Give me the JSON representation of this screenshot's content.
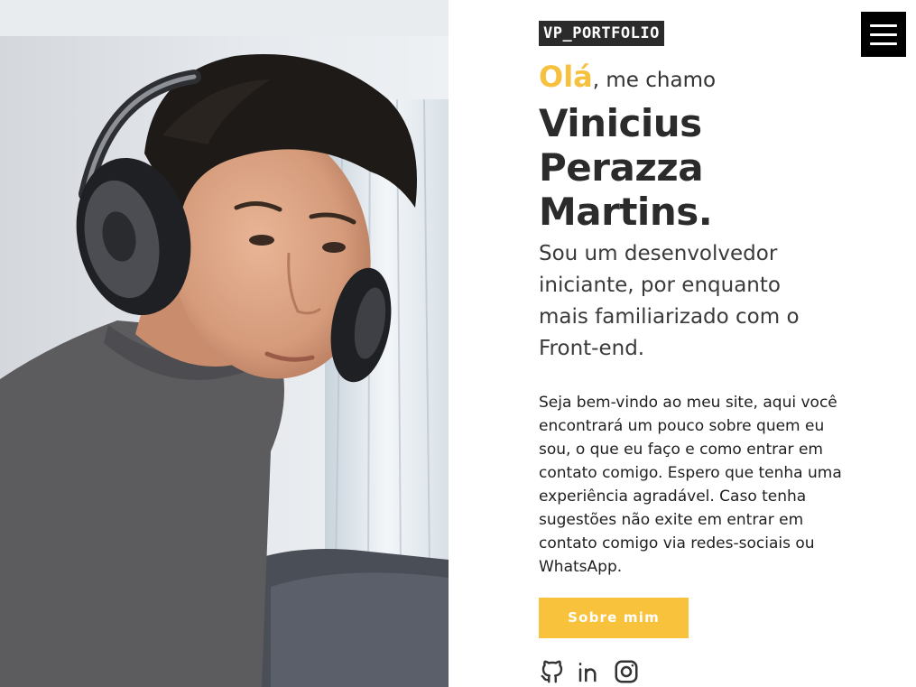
{
  "photo": {
    "alt": "Foto de Vinicius usando fones de ouvido"
  },
  "brand": {
    "label": "VP_PORTFOLIO"
  },
  "greeting": {
    "hello": "Olá",
    "rest": ", me chamo"
  },
  "name": {
    "line1": "Vinicius",
    "line2": "Perazza",
    "line3": "Martins."
  },
  "intro": "Sou um desenvolvedor iniciante, por enquanto mais familiarizado com o Front-end.",
  "about": "Seja bem-vindo ao meu site, aqui você encontrará um pouco sobre quem eu sou, o que eu faço e como entrar em contato comigo. Espero que tenha uma experiência agradável. Caso tenha sugestões não exite em entrar em contato comigo via redes-sociais ou WhatsApp.",
  "cta": {
    "about_label": "Sobre mim"
  },
  "socials": [
    {
      "icon": "github-icon"
    },
    {
      "icon": "linkedin-icon"
    },
    {
      "icon": "instagram-icon"
    }
  ],
  "menu": {
    "icon": "hamburger-menu-icon"
  },
  "colors": {
    "accent": "#f9c23c",
    "dark": "#2b2b2b",
    "menu_bg": "#000000"
  }
}
